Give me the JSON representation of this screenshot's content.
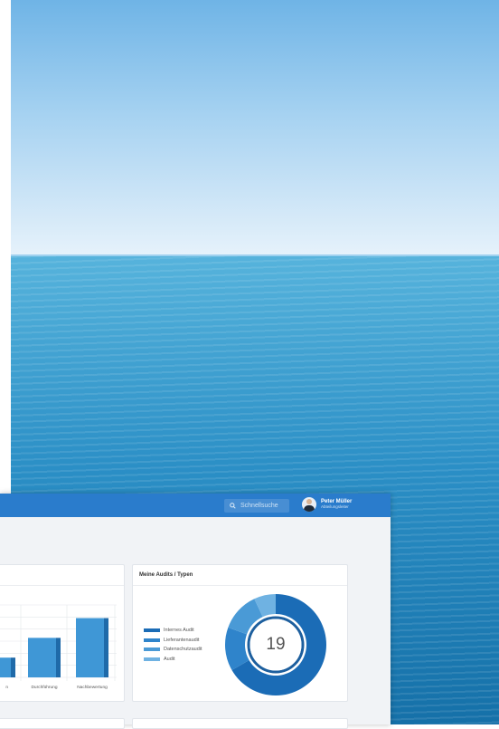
{
  "topbar": {
    "search_placeholder": "Schnellsuche",
    "user_name": "Peter Müller",
    "user_role": "Abteilungsleiter"
  },
  "audit_types_card": {
    "title": "Meine Audits / Typen",
    "total": "19",
    "legend": [
      {
        "label": "Internes Audit",
        "color": "#1b6cb6"
      },
      {
        "label": "Lieferantenaudit",
        "color": "#2f84cb"
      },
      {
        "label": "Datenschutzaudit",
        "color": "#4a9ad6"
      },
      {
        "label": "Audit",
        "color": "#6fb2e2"
      }
    ]
  },
  "chart_data": {
    "type": "bar",
    "categories": [
      "…n",
      "Durchführung",
      "Nachbewertung"
    ],
    "values": [
      3,
      6,
      9
    ],
    "ylim": [
      0,
      11
    ]
  },
  "colors": {
    "accent": "#2a7ccc",
    "bar": "#3f97d6",
    "bar_side": "#1f6aa9"
  }
}
